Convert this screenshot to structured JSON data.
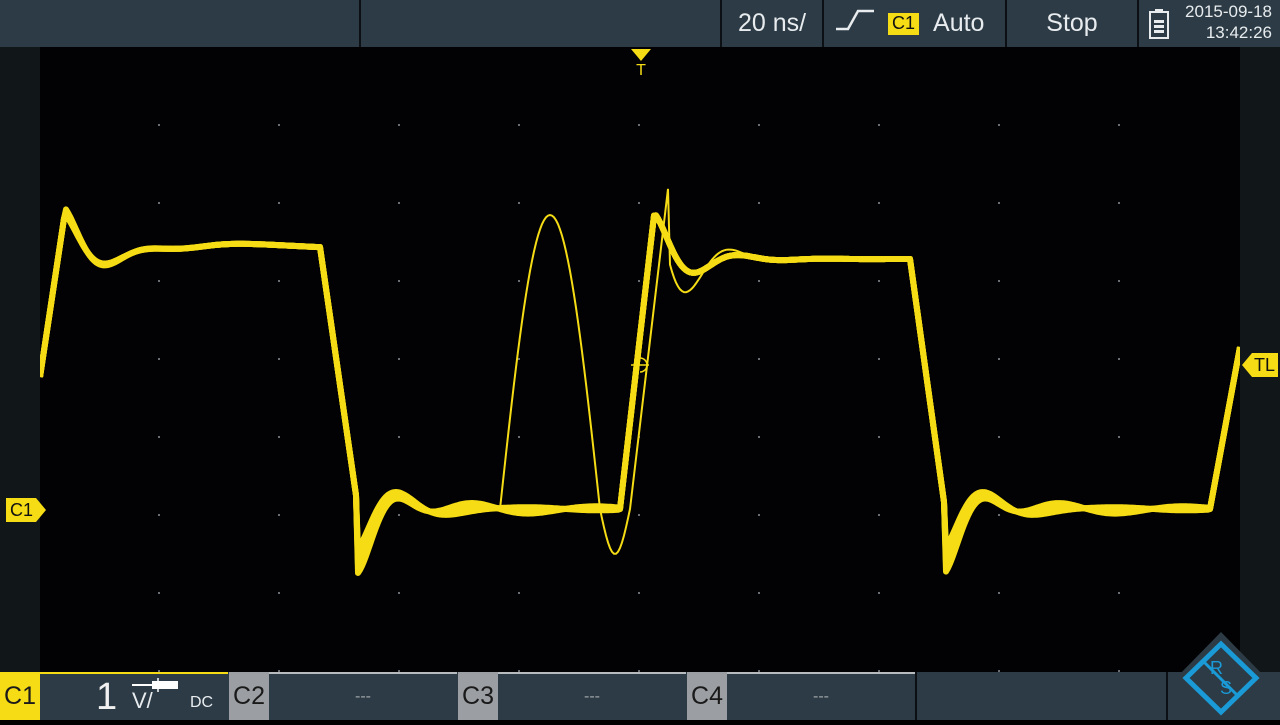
{
  "top_bar": {
    "timebase": "20 ns/",
    "trigger_edge_icon": "rising-edge-icon",
    "trigger_source": "C1",
    "trigger_mode": "Auto",
    "run_state": "Stop",
    "battery_icon": "battery-icon",
    "date": "2015-09-18",
    "time": "13:42:26"
  },
  "markers": {
    "trigger_position": "T",
    "trigger_level": "TL",
    "channel_offset": "C1"
  },
  "bottom_bar": {
    "channels": [
      {
        "label": "C1",
        "scale_value": "1",
        "scale_unit": "V/",
        "coupling": "DC",
        "active": true
      },
      {
        "label": "C2",
        "scale_value": "---",
        "active": false
      },
      {
        "label": "C3",
        "scale_value": "---",
        "active": false
      },
      {
        "label": "C4",
        "scale_value": "---",
        "active": false
      }
    ],
    "logo": "R&S"
  },
  "colors": {
    "trace": "#f5dc14",
    "bar_bg": "#2c3b45",
    "screen_bg": "#020204",
    "logo_blue": "#1a9ad6"
  },
  "waveform": {
    "description": "Persistent C1 digital square wave with ringing; one glitch trace",
    "horizontal_divisions": 10,
    "vertical_divisions": 8
  }
}
